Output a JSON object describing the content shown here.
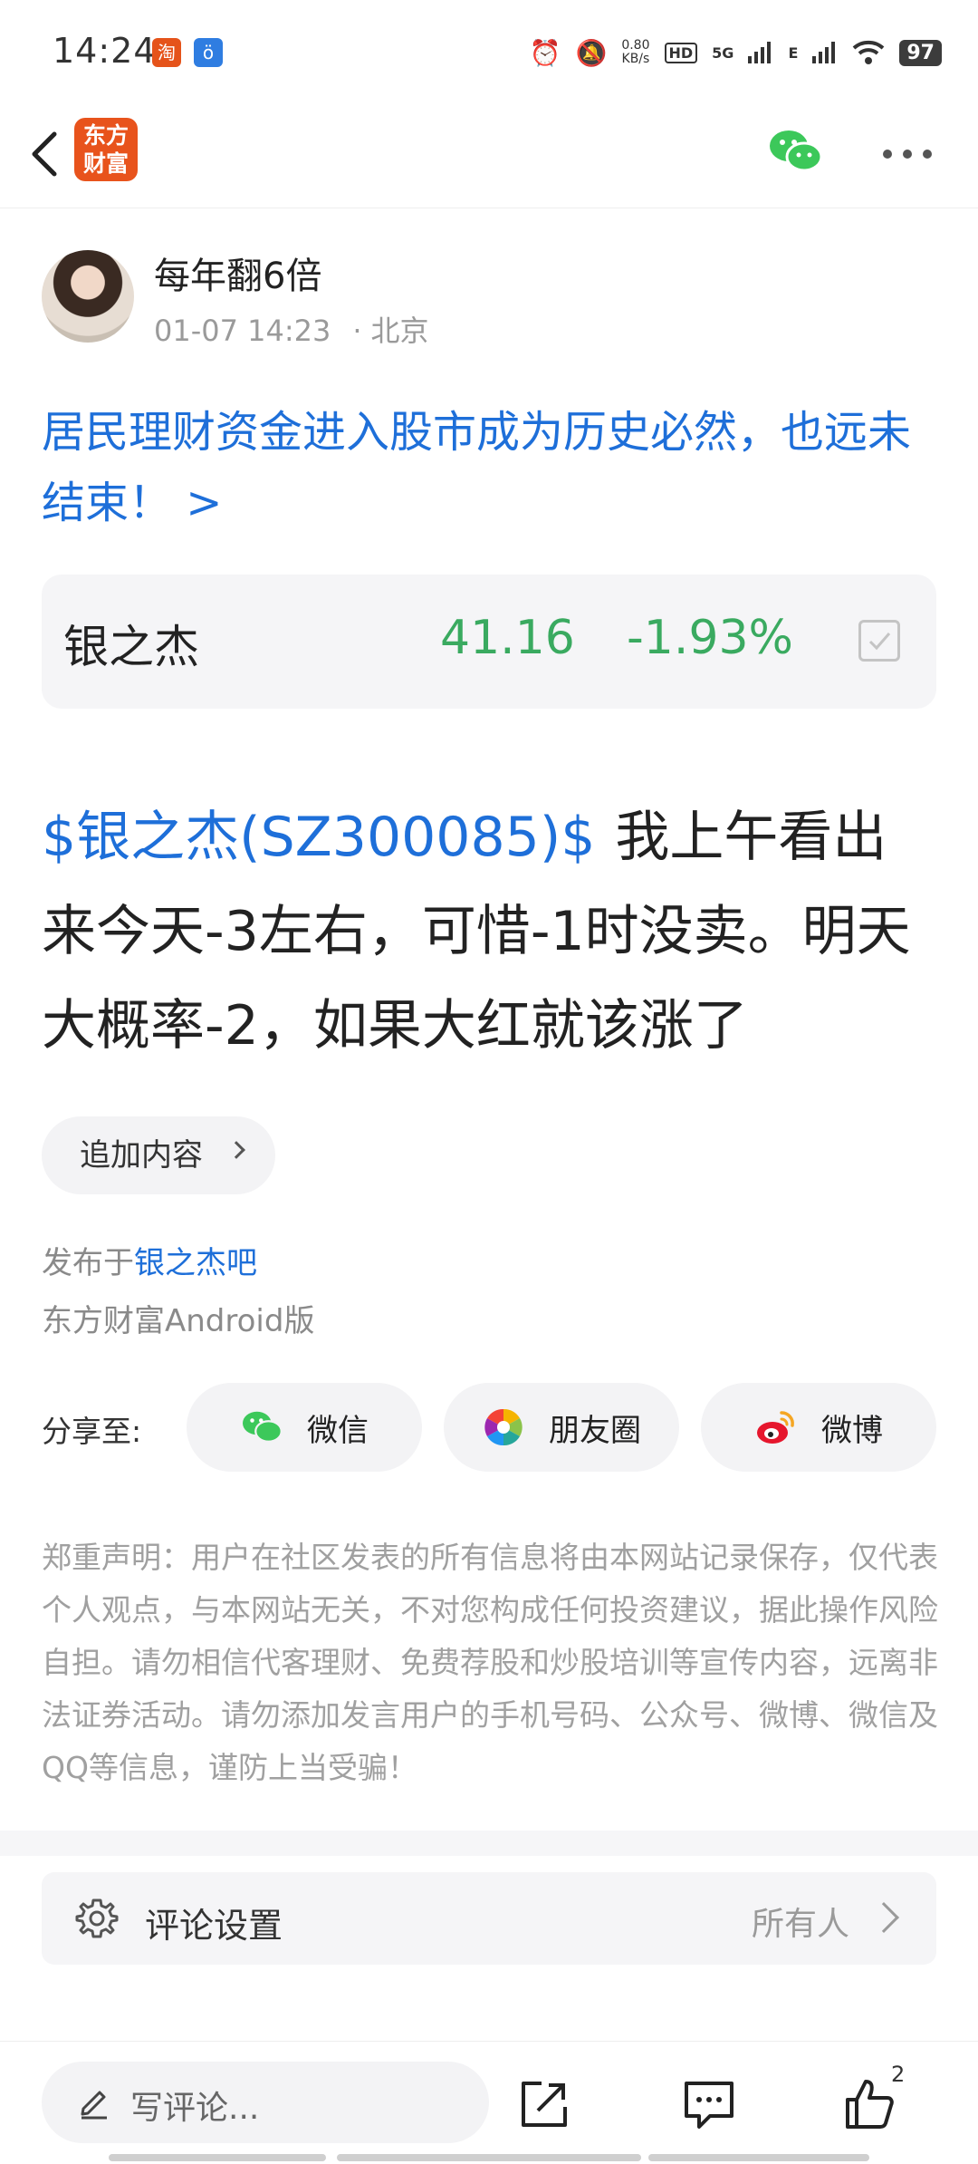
{
  "status_bar": {
    "time": "14:24",
    "app_icon_1": "淘",
    "app_icon_2": "ö",
    "alarm_icon": "⏰",
    "mute_icon": "🔕",
    "net_speed_value": "0.80",
    "net_speed_unit": "KB/s",
    "hd": "HD",
    "signal_1": "5G",
    "signal_2": "E",
    "battery": "97"
  },
  "header": {
    "logo_text_line1": "东方",
    "logo_text_line2": "财富"
  },
  "author": {
    "name": "每年翻6倍",
    "time": "01-07 14:23",
    "separator": "·",
    "location": "北京"
  },
  "title": "居民理财资金进入股市成为历史必然，也远未结束！ >",
  "stock": {
    "name": "银之杰",
    "price": "41.16",
    "change": "-1.93%"
  },
  "post": {
    "stock_tag": "$银之杰(SZ300085)$",
    "text": "我上午看出来今天-3左右，可惜-1时没卖。明天大概率-2，如果大红就该涨了"
  },
  "append_button": "追加内容",
  "published": {
    "prefix": "发布于",
    "bar_name": "银之杰吧"
  },
  "client": "东方财富Android版",
  "share": {
    "label": "分享至:",
    "wechat": "微信",
    "moments": "朋友圈",
    "weibo": "微博"
  },
  "disclaimer": "郑重声明：用户在社区发表的所有信息将由本网站记录保存，仅代表个人观点，与本网站无关，不对您构成任何投资建议，据此操作风险自担。请勿相信代客理财、免费荐股和炒股培训等宣传内容，远离非法证券活动。请勿添加发言用户的手机号码、公众号、微博、微信及QQ等信息，谨防上当受骗！",
  "comment_settings": {
    "label": "评论设置",
    "value": "所有人"
  },
  "bottom_bar": {
    "comment_placeholder": "写评论...",
    "like_count": "2"
  },
  "colors": {
    "link_blue": "#1e6fd9",
    "stock_green": "#3aaa60",
    "brand_orange": "#e8531c",
    "wechat_green": "#3cc85a"
  }
}
